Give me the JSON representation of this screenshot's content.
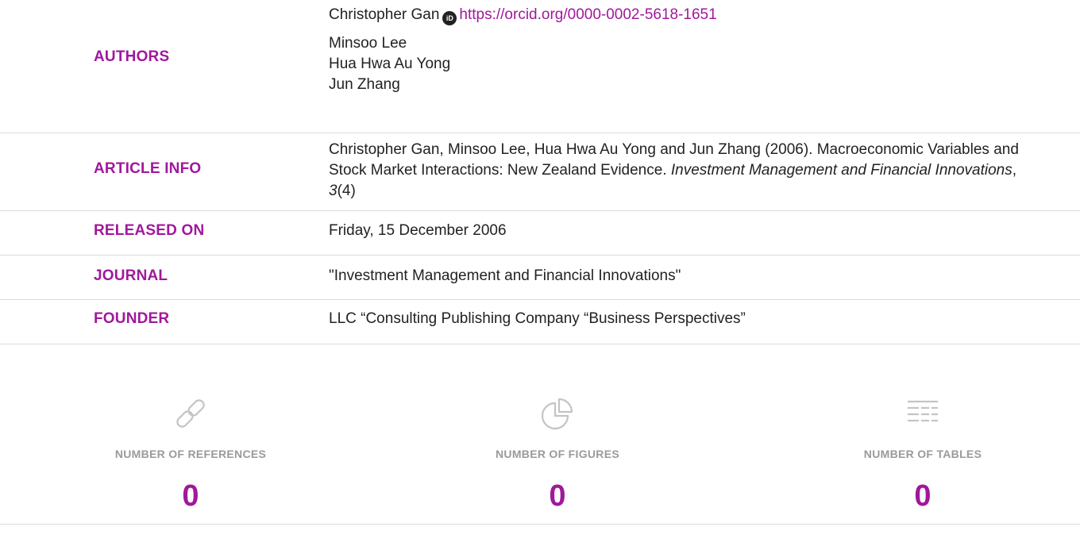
{
  "authors": {
    "label": "AUTHORS",
    "first_author": "Christopher Gan",
    "orcid_icon": "iD",
    "orcid_url": "https://orcid.org/0000-0002-5618-1651",
    "others": [
      "Minsoo Lee",
      "Hua Hwa Au Yong",
      "Jun Zhang"
    ]
  },
  "article_info": {
    "label": "ARTICLE INFO",
    "citation_main": "Christopher Gan, Minsoo Lee, Hua Hwa Au Yong and Jun Zhang (2006). Macroeconomic Variables and Stock Market Interactions: New Zealand Evidence. ",
    "journal_italic": "Investment Management and Financial Innovations",
    "sep": ", ",
    "volume": "3",
    "issue": "(4)"
  },
  "released_on": {
    "label": "RELEASED ON",
    "value": "Friday, 15 December 2006"
  },
  "journal": {
    "label": "JOURNAL",
    "value": "\"Investment Management and Financial Innovations\""
  },
  "founder": {
    "label": "FOUNDER",
    "value": "LLC “Consulting Publishing Company “Business Perspectives”"
  },
  "stats": {
    "icon_color": "#c4c4c4",
    "accent_color": "#a0189c",
    "references": {
      "icon": "link-icon",
      "label": "NUMBER OF REFERENCES",
      "value": "0"
    },
    "figures": {
      "icon": "pie-chart-icon",
      "label": "NUMBER OF FIGURES",
      "value": "0"
    },
    "tables": {
      "icon": "table-icon",
      "label": "NUMBER OF TABLES",
      "value": "0"
    }
  }
}
